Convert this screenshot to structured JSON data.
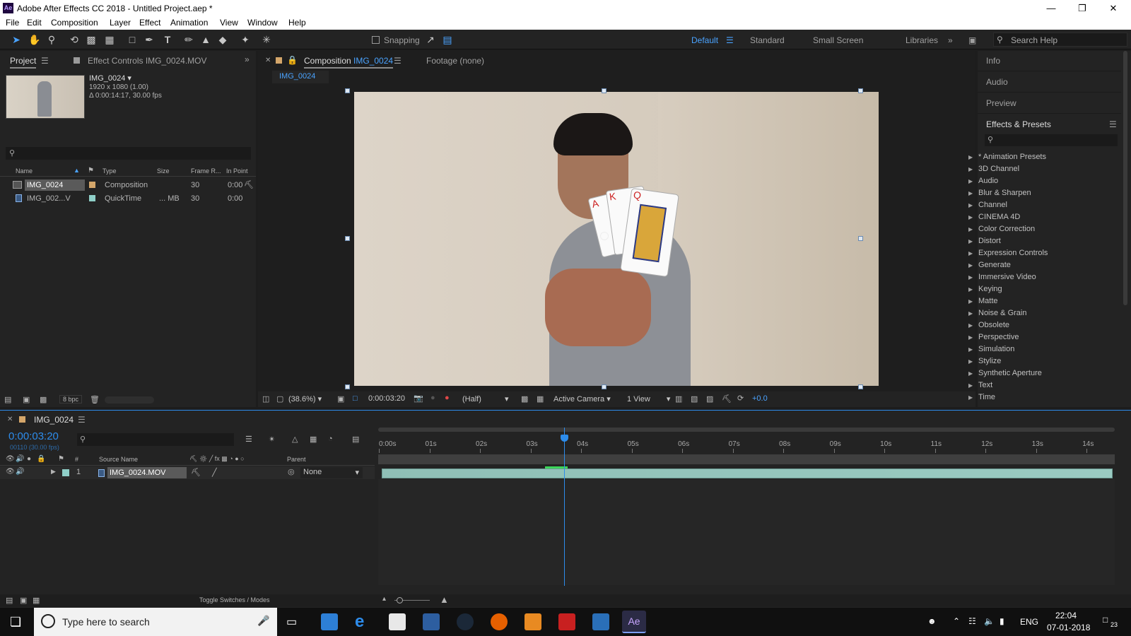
{
  "window": {
    "app_icon": "Ae",
    "title": "Adobe After Effects CC 2018 - Untitled Project.aep *",
    "controls": [
      "minimize-icon",
      "maximize-icon",
      "close-icon"
    ]
  },
  "menu": [
    "File",
    "Edit",
    "Composition",
    "Layer",
    "Effect",
    "Animation",
    "View",
    "Window",
    "Help"
  ],
  "toolbar": {
    "snapping_label": "Snapping",
    "workspaces": [
      "Default",
      "Standard",
      "Small Screen",
      "Libraries"
    ],
    "active_workspace": "Default",
    "search_placeholder": "Search Help"
  },
  "project_panel": {
    "tab_project": "Project",
    "tab_effect_controls": "Effect Controls IMG_0024.MOV",
    "selected_name": "IMG_0024 ▾",
    "selected_info_1": "1920 x 1080 (1.00)",
    "selected_info_2": "Δ 0:00:14:17, 30.00 fps",
    "columns": [
      "Name",
      "Type",
      "Size",
      "Frame R...",
      "In Point"
    ],
    "items": [
      {
        "name": "IMG_0024",
        "type": "Composition",
        "size": "",
        "frame_rate": "30",
        "in_point": "0:00"
      },
      {
        "name": "IMG_002...V",
        "type": "QuickTime",
        "size": "... MB",
        "frame_rate": "30",
        "in_point": "0:00"
      }
    ],
    "bpc": "8 bpc"
  },
  "composition_panel": {
    "tab_label": "Composition",
    "tab_comp_name": "IMG_0024",
    "footage_tab": "Footage (none)",
    "breadcrumb": "IMG_0024",
    "zoom": "(38.6%)",
    "timecode": "0:00:03:20",
    "resolution": "(Half)",
    "camera": "Active Camera",
    "views": "1 View",
    "exposure": "+0.0"
  },
  "right_panel": {
    "sections": [
      "Info",
      "Audio",
      "Preview"
    ],
    "effects_title": "Effects & Presets",
    "effects": [
      "* Animation Presets",
      "3D Channel",
      "Audio",
      "Blur & Sharpen",
      "Channel",
      "CINEMA 4D",
      "Color Correction",
      "Distort",
      "Expression Controls",
      "Generate",
      "Immersive Video",
      "Keying",
      "Matte",
      "Noise & Grain",
      "Obsolete",
      "Perspective",
      "Simulation",
      "Stylize",
      "Synthetic Aperture",
      "Text",
      "Time"
    ]
  },
  "timeline": {
    "tab_name": "IMG_0024",
    "timecode": "0:00:03:20",
    "frame_info": "00110 (30.00 fps)",
    "col_num": "#",
    "col_source": "Source Name",
    "col_parent": "Parent",
    "layer_index": "1",
    "layer_name": "IMG_0024.MOV",
    "parent_value": "None",
    "ruler": [
      "0:00s",
      "01s",
      "02s",
      "03s",
      "04s",
      "05s",
      "06s",
      "07s",
      "08s",
      "09s",
      "10s",
      "11s",
      "12s",
      "13s",
      "14s"
    ],
    "playhead_time_s": 3.67,
    "duration_s": 14.57,
    "toggle_label": "Toggle Switches / Modes"
  },
  "taskbar": {
    "search_placeholder": "Type here to search",
    "lang": "ENG",
    "time": "22:04",
    "date": "07-01-2018",
    "notifications": "23"
  },
  "colors": {
    "accent_blue": "#2d8ceb",
    "panel_bg": "#232323",
    "layer_bar": "#8fbfb6"
  }
}
